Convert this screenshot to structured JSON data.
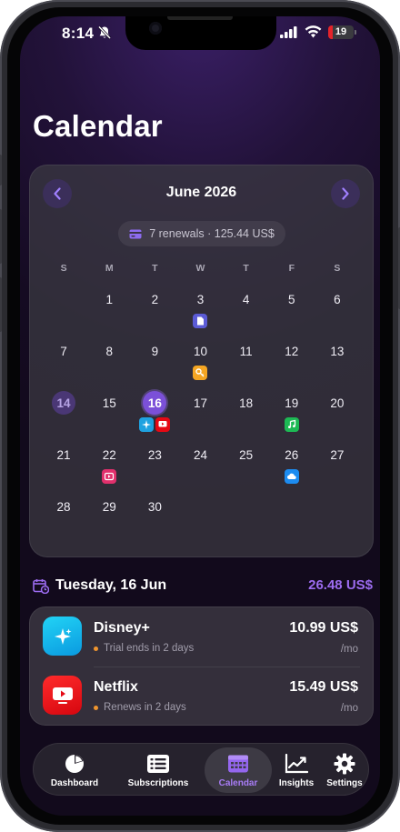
{
  "status_bar": {
    "time": "8:14",
    "battery": "19",
    "battery_level": 0.19
  },
  "page_title": "Calendar",
  "calendar": {
    "month_label": "June 2026",
    "summary": "7 renewals · 125.44 US$",
    "weekdays": [
      "S",
      "M",
      "T",
      "W",
      "T",
      "F",
      "S"
    ],
    "leading_blanks": 1,
    "days": [
      {
        "day": "1"
      },
      {
        "day": "2"
      },
      {
        "day": "3",
        "badges": [
          {
            "icon": "document-icon",
            "color": "#5b5bd6"
          }
        ]
      },
      {
        "day": "4"
      },
      {
        "day": "5"
      },
      {
        "day": "6"
      },
      {
        "day": "7"
      },
      {
        "day": "8"
      },
      {
        "day": "9"
      },
      {
        "day": "10",
        "badges": [
          {
            "icon": "key-icon",
            "color": "#f5a623"
          }
        ]
      },
      {
        "day": "11"
      },
      {
        "day": "12"
      },
      {
        "day": "13"
      },
      {
        "day": "14",
        "state": "today"
      },
      {
        "day": "15"
      },
      {
        "day": "16",
        "state": "selected",
        "badges": [
          {
            "icon": "sparkle-icon",
            "color": "#1fa2e0"
          },
          {
            "icon": "netflix-play-icon",
            "color": "#e50914"
          }
        ]
      },
      {
        "day": "17"
      },
      {
        "day": "18"
      },
      {
        "day": "19",
        "badges": [
          {
            "icon": "music-note-icon",
            "color": "#1db954"
          }
        ]
      },
      {
        "day": "20"
      },
      {
        "day": "21"
      },
      {
        "day": "22",
        "badges": [
          {
            "icon": "video-play-icon",
            "color": "#e1306c"
          }
        ]
      },
      {
        "day": "23"
      },
      {
        "day": "24"
      },
      {
        "day": "25"
      },
      {
        "day": "26",
        "badges": [
          {
            "icon": "cloud-icon",
            "color": "#1d8cf0"
          }
        ]
      },
      {
        "day": "27"
      },
      {
        "day": "28"
      },
      {
        "day": "29"
      },
      {
        "day": "30"
      }
    ]
  },
  "selected_day": {
    "label": "Tuesday, 16 Jun",
    "total": "26.48 US$",
    "subscriptions": [
      {
        "name": "Disney+",
        "status": "Trial ends in 2 days",
        "price": "10.99 US$",
        "period": "/mo",
        "icon": "sparkle-icon",
        "color": "#1ab8f0"
      },
      {
        "name": "Netflix",
        "status": "Renews in 2 days",
        "price": "15.49 US$",
        "period": "/mo",
        "icon": "netflix-play-icon",
        "color": "#e50914"
      }
    ]
  },
  "tabs": [
    {
      "label": "Dashboard",
      "icon": "pie-chart-icon"
    },
    {
      "label": "Subscriptions",
      "icon": "list-icon"
    },
    {
      "label": "Calendar",
      "icon": "calendar-icon",
      "active": true
    },
    {
      "label": "Insights",
      "icon": "trend-chart-icon"
    },
    {
      "label": "Settings",
      "icon": "gear-icon"
    }
  ],
  "colors": {
    "accent": "#9c6cf0",
    "selected_day": "#7b50d8",
    "status_dot": "#f0952f"
  }
}
